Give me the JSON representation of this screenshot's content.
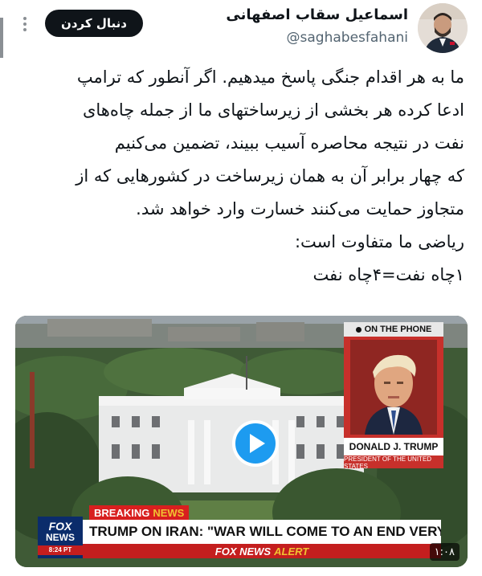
{
  "header": {
    "follow_label": "دنبال کردن",
    "author_name": "اسماعیل سقاب اصفهانی",
    "author_handle": "@saghabesfahani",
    "more_icon": "more-options-icon"
  },
  "tweet": {
    "text": "ما به هر اقدام جنگی پاسخ میدهیم. اگر آنطور که ترامپ\nادعا کرده هر بخشی از زیرساختهای ما از جمله چاه‌های\nنفت در نتیجه محاصره آسیب ببیند، تضمین می‌کنیم\nکه چهار برابر آن به همان زیرساخت در کشورهایی که از\nمتجاوز حمایت می‌کنند خسارت وارد خواهد شد.\nریاضی ما متفاوت است:\n۱چاه نفت=۴چاه نفت"
  },
  "video": {
    "on_the_phone": "ON THE PHONE",
    "portrait_name": "DONALD J. TRUMP",
    "portrait_title": "PRESIDENT OF THE UNITED STATES",
    "breaking": "BREAKING",
    "breaking_news": "NEWS",
    "headline": "TRUMP ON IRAN: \"WAR WILL COME TO AN END VERY SOON\"",
    "alert_brand": "FOX NEWS",
    "alert_word": "ALERT",
    "logo_line1": "FOX",
    "logo_line2": "NEWS",
    "logo_time": "8:24 PT",
    "duration": "۱:۰۸",
    "play_icon": "play-icon"
  },
  "colors": {
    "follow_bg": "#0f1419",
    "play_button": "#1d9bf0",
    "handle_gray": "#536471",
    "fox_red": "#c41e1e",
    "fox_blue": "#0b2c6b"
  }
}
